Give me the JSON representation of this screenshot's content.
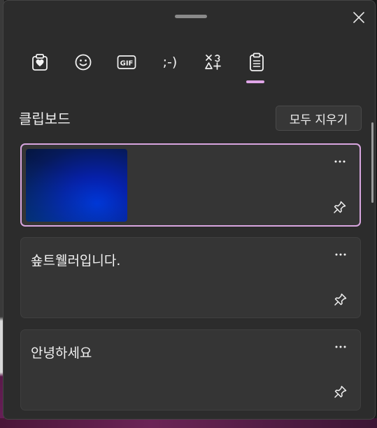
{
  "window": {
    "close_icon": "close-icon",
    "drag_handle": "drag-handle"
  },
  "tabs": [
    {
      "name": "tab-favorites",
      "icon": "heart-clipboard-icon"
    },
    {
      "name": "tab-emoji",
      "icon": "smiley-icon"
    },
    {
      "name": "tab-gif",
      "icon": "gif-icon",
      "label": "GIF"
    },
    {
      "name": "tab-kaomoji",
      "icon": "kaomoji-icon",
      "label": ";-)"
    },
    {
      "name": "tab-symbols",
      "icon": "symbols-icon"
    },
    {
      "name": "tab-clipboard",
      "icon": "clipboard-icon",
      "selected": true
    }
  ],
  "clipboard": {
    "title": "클립보드",
    "clear_all_label": "모두 지우기",
    "items": [
      {
        "type": "image",
        "selected": true,
        "description": ""
      },
      {
        "type": "text",
        "text": "숖트웰러입니다."
      },
      {
        "type": "text",
        "text": "안녕하세요"
      }
    ]
  },
  "colors": {
    "panel_bg": "#2c2c2c",
    "card_bg": "#353535",
    "accent": "#d9a6e0"
  }
}
